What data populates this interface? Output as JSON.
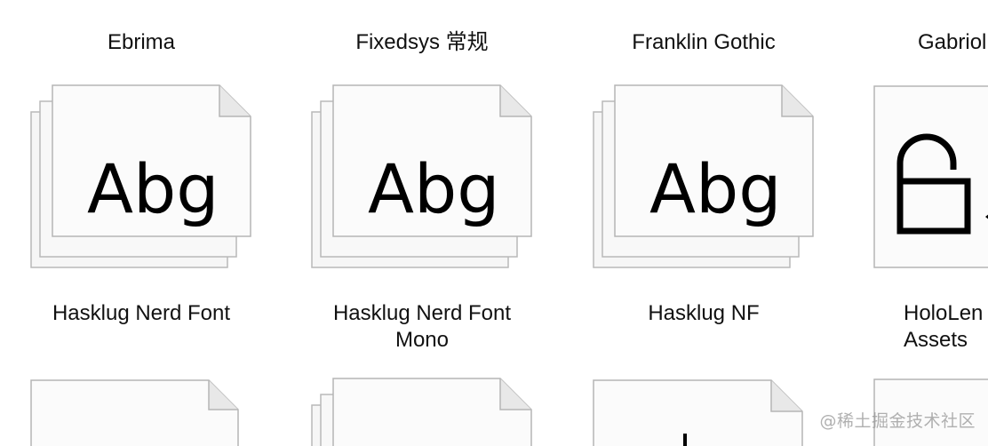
{
  "fonts": [
    {
      "name": "Ebrima",
      "preview": "Abg",
      "icon": "font-file-stack-icon"
    },
    {
      "name": "Fixedsys 常规",
      "preview": "Abg",
      "icon": "font-file-stack-icon"
    },
    {
      "name": "Franklin Gothic",
      "preview": "Abg",
      "icon": "font-file-stack-icon"
    },
    {
      "name": "Gabriol",
      "preview": "",
      "icon": "unlock-icon"
    },
    {
      "name": "Hasklug Nerd Font",
      "preview": "",
      "icon": "font-file-stack-icon"
    },
    {
      "name": "Hasklug Nerd Font\nMono",
      "preview": "",
      "icon": "font-file-stack-icon"
    },
    {
      "name": "Hasklug NF",
      "preview": "",
      "icon": "font-file-icon"
    },
    {
      "name": "HoloLen\nAssets",
      "preview": "",
      "icon": "font-file-icon"
    }
  ],
  "watermark": "@稀土掘金技术社区"
}
